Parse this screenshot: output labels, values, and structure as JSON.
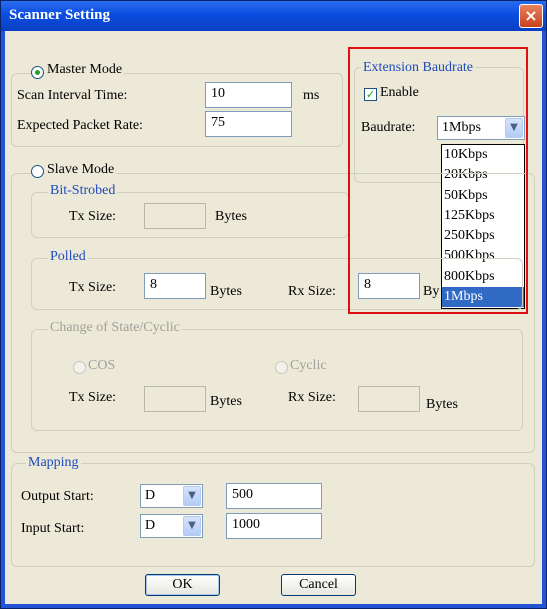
{
  "window": {
    "title": "Scanner Setting",
    "close_icon": "×"
  },
  "master": {
    "label": "Master Mode",
    "scan_interval_label": "Scan Interval Time:",
    "scan_interval_value": "10",
    "scan_interval_unit": "ms",
    "packet_rate_label": "Expected Packet Rate:",
    "packet_rate_value": "75"
  },
  "ext": {
    "legend": "Extension Baudrate",
    "enable_label": "Enable",
    "baudrate_label": "Baudrate:",
    "baudrate_value": "1Mbps",
    "options": [
      "10Kbps",
      "20Kbps",
      "50Kbps",
      "125Kbps",
      "250Kbps",
      "500Kbps",
      "800Kbps",
      "1Mbps"
    ]
  },
  "slave": {
    "label": "Slave Mode",
    "bitstrobed": {
      "legend": "Bit-Strobed",
      "tx_label": "Tx Size:",
      "tx_unit": "Bytes"
    },
    "polled": {
      "legend": "Polled",
      "tx_label": "Tx Size:",
      "tx_value": "8",
      "tx_unit": "Bytes",
      "rx_label": "Rx Size:",
      "rx_value": "8",
      "rx_unit": "By"
    },
    "cos": {
      "legend": "Change of State/Cyclic",
      "cos_label": "COS",
      "cyclic_label": "Cyclic",
      "tx_label": "Tx Size:",
      "tx_unit": "Bytes",
      "rx_label": "Rx Size:",
      "rx_unit": "Bytes"
    }
  },
  "mapping": {
    "legend": "Mapping",
    "output_label": "Output Start:",
    "output_device": "D",
    "output_value": "500",
    "input_label": "Input Start:",
    "input_device": "D",
    "input_value": "1000"
  },
  "buttons": {
    "ok": "OK",
    "cancel": "Cancel"
  },
  "icons": {
    "dropdown_arrow": "▼",
    "check": "✓"
  },
  "colors": {
    "titlebar": "#0b4de0",
    "dialog_bg": "#ece9d8",
    "selection": "#316ac5",
    "highlight_box": "#e01010",
    "group_label": "#1f4bbd"
  }
}
